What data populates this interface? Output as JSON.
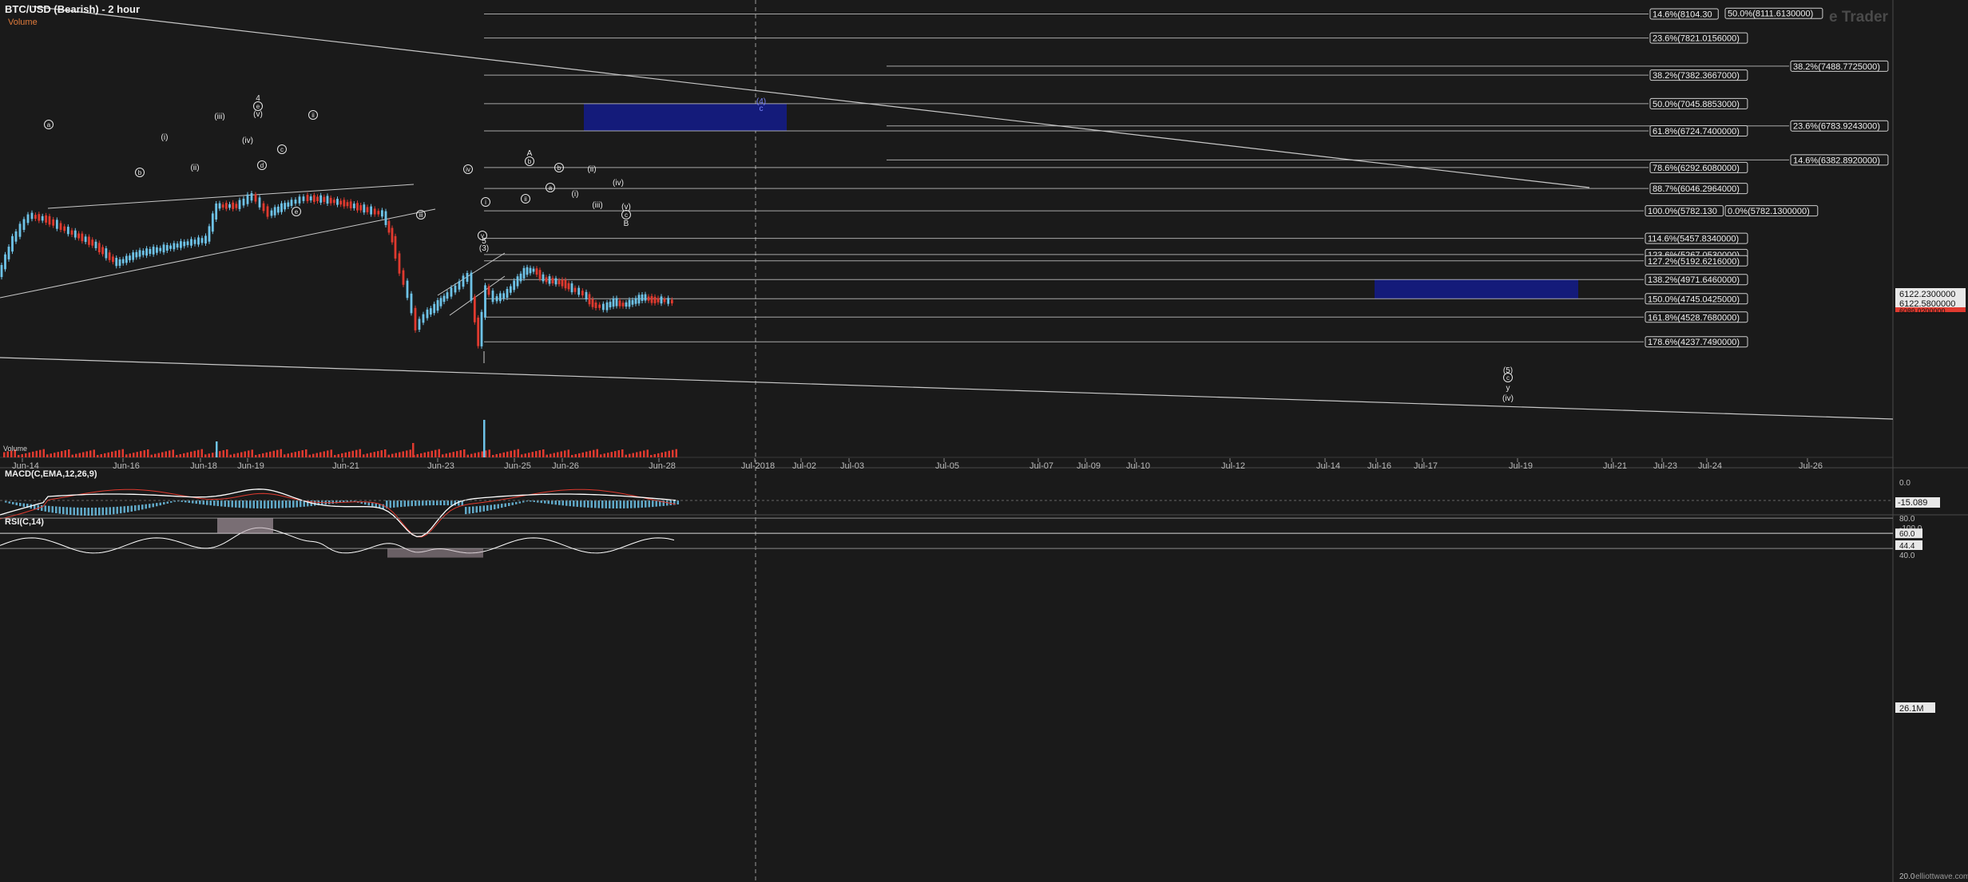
{
  "header": {
    "title": "BTC/USD (Bearish) - 2 hour",
    "subtitle": "Volume",
    "watermark": "e Trader",
    "footer": "elliottwave.com",
    "volume_overlay": "Volume"
  },
  "colors": {
    "background": "#1a1a1a",
    "up_candle": "#6ec3e8",
    "down_candle": "#e03a2f",
    "fib_line": "#d8d8d8",
    "target_box": "#141b7a",
    "macd_line": "#ffffff",
    "signal_line": "#e03a2f",
    "rsi_line": "#ffffff",
    "macd_hist": "#6ec3e8",
    "rsi_fill_over": "#b9a6b0"
  },
  "chart_data": {
    "type": "candlestick",
    "title": "BTC/USD (Bearish) - 2 hour",
    "x_tick_labels": [
      "Jun-14",
      "Jun-16",
      "Jun-18",
      "Jun-19",
      "Jun-21",
      "Jun-23",
      "Jun-25",
      "Jun-26",
      "Jun-28",
      "Jul-2018",
      "Jul-02",
      "Jul-03",
      "Jul-05",
      "Jul-07",
      "Jul-09",
      "Jul-10",
      "Jul-12",
      "Jul-14",
      "Jul-16",
      "Jul-17",
      "Jul-19",
      "Jul-21",
      "Jul-23",
      "Jul-24",
      "Jul-26"
    ],
    "price_labels": [
      "6122.2300000",
      "6122.5800000",
      "6089.0200000"
    ],
    "volume_label": "26.1M",
    "fib_levels": [
      {
        "label": "14.6%(8104.30",
        "value": 8104.3
      },
      {
        "label": "50.0%(8111.6130000)",
        "value": 8111.613
      },
      {
        "label": "23.6%(7821.0156000)",
        "value": 7821.0156
      },
      {
        "label": "38.2%(7488.7725000)",
        "value": 7488.7725
      },
      {
        "label": "38.2%(7382.3667000)",
        "value": 7382.3667
      },
      {
        "label": "50.0%(7045.8853000)",
        "value": 7045.8853
      },
      {
        "label": "23.6%(6783.9243000)",
        "value": 6783.9243
      },
      {
        "label": "61.8%(6724.7400000)",
        "value": 6724.74
      },
      {
        "label": "14.6%(6382.8920000)",
        "value": 6382.892
      },
      {
        "label": "78.6%(6292.6080000)",
        "value": 6292.608
      },
      {
        "label": "88.7%(6046.2964000)",
        "value": 6046.2964
      },
      {
        "label": "100.0%(5782.130",
        "value": 5782.13
      },
      {
        "label": "0.0%(5782.1300000)",
        "value": 5782.13
      },
      {
        "label": "114.6%(5457.8340000)",
        "value": 5457.834
      },
      {
        "label": "123.6%(5267.0530000)",
        "value": 5267.053
      },
      {
        "label": "127.2%(5192.6216000)",
        "value": 5192.6216
      },
      {
        "label": "138.2%(4971.6460000)",
        "value": 4971.646
      },
      {
        "label": "150.0%(4745.0425000)",
        "value": 4745.0425
      },
      {
        "label": "161.8%(4528.7680000)",
        "value": 4528.768
      },
      {
        "label": "178.6%(4237.7490000)",
        "value": 4237.749
      }
    ],
    "wave_labels": [
      "a",
      "b",
      "c",
      "d",
      "e",
      "i",
      "ii",
      "iii",
      "iv",
      "v",
      "(i)",
      "(ii)",
      "(iii)",
      "(iv)",
      "(v)",
      "4",
      "5",
      "(3)",
      "A",
      "B",
      "(4)",
      "c",
      "(5)",
      "y",
      "(iv)"
    ],
    "macd": {
      "label": "MACD(C,EMA,12,26,9)",
      "ticks": [
        "0.0",
        "-15.089",
        "-100.0"
      ]
    },
    "rsi": {
      "label": "RSI(C,14)",
      "ticks": [
        "80.0",
        "60.0",
        "44.4",
        "40.0",
        "20.0"
      ]
    }
  }
}
